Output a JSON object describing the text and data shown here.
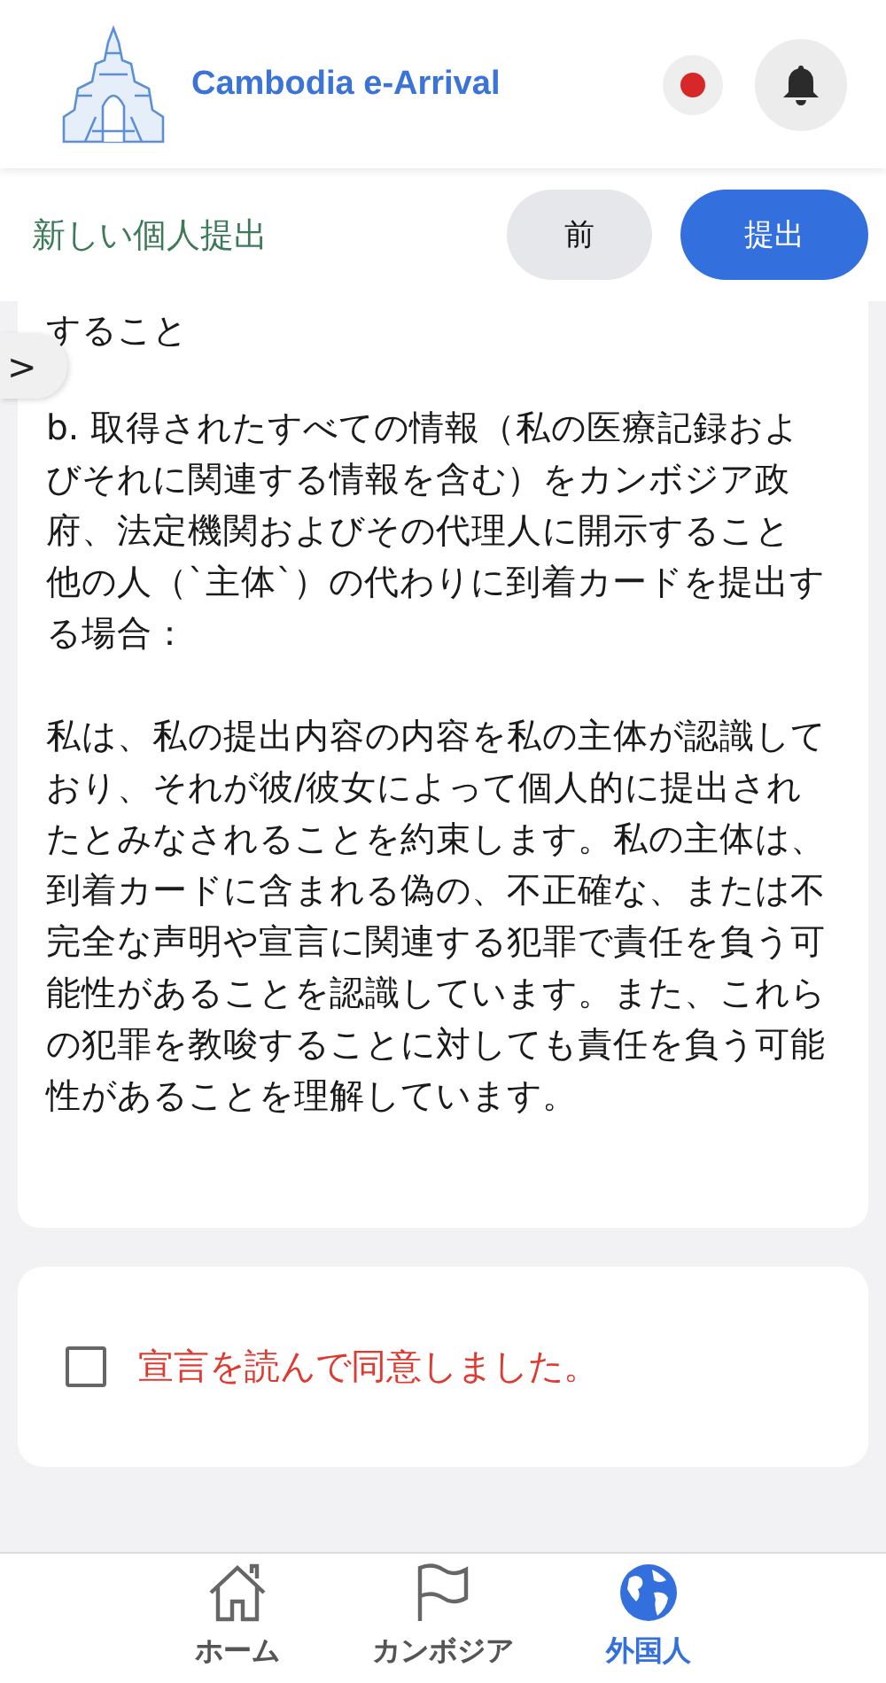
{
  "header": {
    "title": "Cambodia e-Arrival"
  },
  "toolbar": {
    "title": "新しい個人提出",
    "buttons": [
      {
        "label": "前",
        "kind": "secondary"
      },
      {
        "label": "提出",
        "kind": "primary"
      }
    ]
  },
  "side_toggle": {
    "label": ">"
  },
  "declaration": {
    "paragraphs": [
      {
        "kind": "line",
        "text": "すること"
      },
      {
        "kind": "item",
        "text": "b. 取得されたすべての情報（私の医療記録およびそれに関連する情報を含む）をカンボジア政府、法定機関およびその代理人に開示すること"
      },
      {
        "kind": "line",
        "text": "他の人（`主体`）の代わりに到着カードを提出する場合："
      },
      {
        "kind": "section",
        "text": "私は、私の提出内容の内容を私の主体が認識しており、それが彼/彼女によって個人的に提出されたとみなされることを約束します。私の主体は、到着カードに含まれる偽の、不正確な、または不完全な声明や宣言に関連する犯罪で責任を負う可能性があることを認識しています。また、これらの犯罪を教唆することに対しても責任を負う可能性があることを理解しています。"
      }
    ]
  },
  "agreement": {
    "label": "宣言を読んで同意しました。",
    "checked": false
  },
  "bottom_nav": [
    {
      "label": "ホーム",
      "selected": false
    },
    {
      "label": "カンボジア",
      "selected": false
    },
    {
      "label": "外国人",
      "selected": true
    }
  ]
}
